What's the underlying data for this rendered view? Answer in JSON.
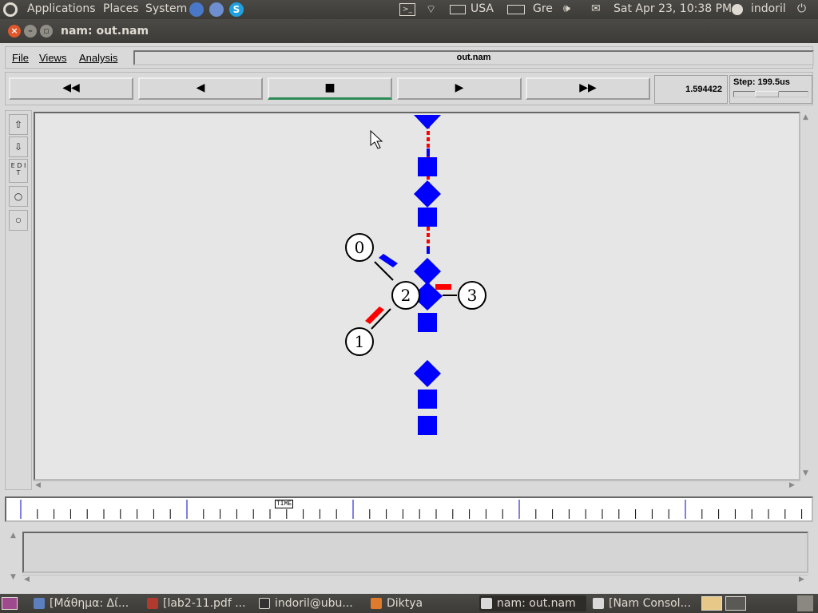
{
  "top_panel": {
    "menus": [
      "Applications",
      "Places",
      "System"
    ],
    "keyboard": "USA",
    "keyboard2": "Gre",
    "datetime": "Sat Apr 23, 10:38 PM",
    "user": "indoril"
  },
  "window": {
    "title": "nam: out.nam"
  },
  "menubar": {
    "file": "File",
    "views": "Views",
    "analysis": "Analysis",
    "filename": "out.nam"
  },
  "controls": {
    "rewind": "◀◀",
    "back": "◀",
    "stop": "■",
    "play": "▶",
    "fastforward": "▶▶",
    "time": "1.594422",
    "step_label": "Step: 199.5us"
  },
  "tools": {
    "edit": "E D I T"
  },
  "topology": {
    "nodes": [
      {
        "id": "0",
        "label": "0"
      },
      {
        "id": "1",
        "label": "1"
      },
      {
        "id": "2",
        "label": "2"
      },
      {
        "id": "3",
        "label": "3"
      }
    ],
    "links": [
      [
        "0",
        "2"
      ],
      [
        "1",
        "2"
      ],
      [
        "2",
        "3"
      ]
    ],
    "colors": {
      "flow_blue": "#0000ff",
      "flow_red": "#ff0000",
      "link": "#000000"
    }
  },
  "timeline": {
    "label": "TIME"
  },
  "taskbar": {
    "tasks": [
      {
        "label": "[Μάθημα: Δί...",
        "color": "#5b7fbf"
      },
      {
        "label": "[lab2-11.pdf ...",
        "color": "#b13a2e"
      },
      {
        "label": "indoril@ubu...",
        "color": "#333333"
      },
      {
        "label": "Diktya",
        "color": "#e07b2e"
      },
      {
        "label": "nam: out.nam",
        "color": "#d9d9d9"
      },
      {
        "label": "[Nam Consol...",
        "color": "#d9d9d9"
      }
    ]
  }
}
